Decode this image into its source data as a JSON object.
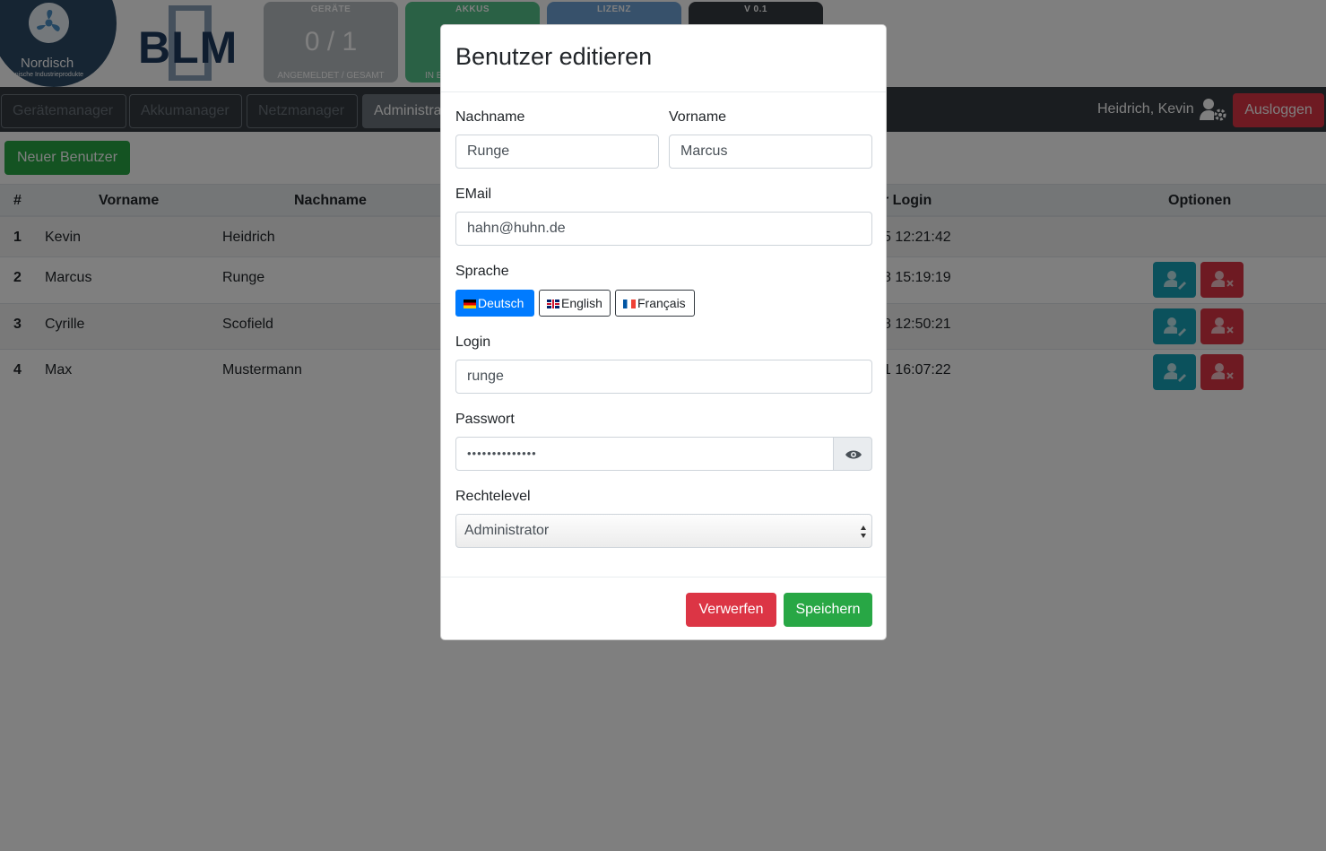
{
  "logo": {
    "name": "Nordisch",
    "tagline": "Technische Industrieprodukte",
    "product": "BLM"
  },
  "tiles": {
    "geraete": {
      "label": "GERÄTE",
      "value": "0 / 1",
      "footer": "ANGEMELDET / GESAMT"
    },
    "akkus": {
      "label": "AKKUS",
      "footer": "IN E"
    },
    "lizenz": {
      "label": "LIZENZ"
    },
    "version": {
      "label": "V 0.1"
    }
  },
  "nav": {
    "items": [
      "Gerätemanager",
      "Akkumanager",
      "Netzmanager",
      "Administra"
    ],
    "user": "Heidrich, Kevin",
    "logout": "Ausloggen"
  },
  "content": {
    "new_user_button": "Neuer Benutzer",
    "table": {
      "headers": {
        "num": "#",
        "vorname": "Vorname",
        "nachname": "Nachname",
        "login": "r Login",
        "options": "Optionen"
      },
      "rows": [
        {
          "num": "1",
          "vorname": "Kevin",
          "nachname": "Heidrich",
          "login": "5 12:21:42"
        },
        {
          "num": "2",
          "vorname": "Marcus",
          "nachname": "Runge",
          "login": "8 15:19:19"
        },
        {
          "num": "3",
          "vorname": "Cyrille",
          "nachname": "Scofield",
          "login": "8 12:50:21"
        },
        {
          "num": "4",
          "vorname": "Max",
          "nachname": "Mustermann",
          "login": "1 16:07:22"
        }
      ]
    }
  },
  "modal": {
    "title": "Benutzer editieren",
    "nachname_label": "Nachname",
    "nachname_value": "Runge",
    "vorname_label": "Vorname",
    "vorname_value": "Marcus",
    "email_label": "EMail",
    "email_value": "hahn@huhn.de",
    "sprache_label": "Sprache",
    "languages": [
      "Deutsch",
      "English",
      "Français"
    ],
    "selected_language": "Deutsch",
    "login_label": "Login",
    "login_value": "runge",
    "passwort_label": "Passwort",
    "passwort_value": "••••••••••••••",
    "rechte_label": "Rechtelevel",
    "rechte_value": "Administrator",
    "discard": "Verwerfen",
    "save": "Speichern"
  },
  "colors": {
    "primary": "#007bff",
    "danger": "#dc3545",
    "success": "#28a745",
    "info": "#17a2b8",
    "dark": "#343a40"
  }
}
